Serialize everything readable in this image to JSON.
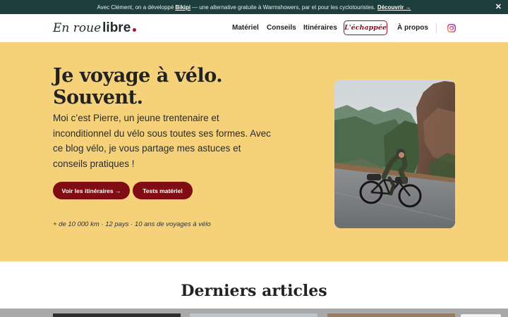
{
  "announcement": {
    "prefix": "Avec Clément, on a développé",
    "link": "Bikipi",
    "middle": "— une alternative gratuite à Warmshowers, par et pour les cyclotouristes.",
    "cta": "Découvrir →",
    "close": "✕"
  },
  "header": {
    "logo_italic": "En roue",
    "logo_bold": "libre",
    "nav": [
      {
        "label": "Matériel"
      },
      {
        "label": "Conseils"
      },
      {
        "label": "Itinéraires"
      }
    ],
    "special": "L'échappée",
    "about": "À propos",
    "social_icon": "instagram-icon"
  },
  "hero": {
    "title_line1": "Je voyage à vélo.",
    "title_line2": "Souvent.",
    "intro": "Moi c’est Pierre, un jeune trentenaire et inconditionnel du vélo sous toutes ses formes. Avec ce blog vélo, je vous partage mes astuces et conseils pratiques !",
    "btn_itineraires": "Voir les itinéraires →",
    "btn_tests": "Tests matériel",
    "stats": "+ de 10 000 km · 12 pays · 10 ans de voyages à vélo"
  },
  "articles": {
    "heading": "Derniers articles"
  },
  "colors": {
    "hero_bg": "#f5d27a",
    "primary_button": "#800d13",
    "announcement_bg": "#1e3d3d",
    "accent": "#8c1621"
  }
}
